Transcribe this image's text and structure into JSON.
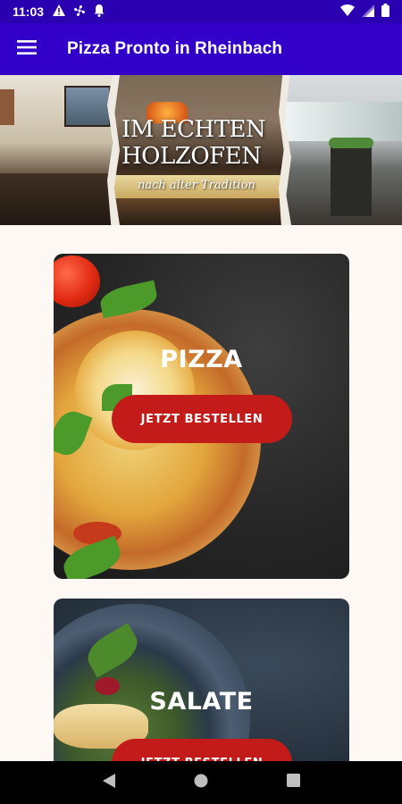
{
  "status_bar": {
    "time": "11:03",
    "icons_left": [
      "alert-icon",
      "fan-icon",
      "bell-icon"
    ],
    "icons_right": [
      "wifi-icon",
      "signal-icon",
      "battery-icon"
    ]
  },
  "app_bar": {
    "title": "Pizza Pronto in Rheinbach",
    "menu_icon": "hamburger-menu-icon"
  },
  "hero": {
    "headline_line1": "IM ECHTEN",
    "headline_line2": "HOLZOFEN",
    "subline": "nach alter Tradition"
  },
  "categories": [
    {
      "title": "PIZZA",
      "button_label": "JETZT BESTELLEN"
    },
    {
      "title": "SALATE",
      "button_label": "JETZT BESTELLEN"
    }
  ],
  "nav_bar": {
    "buttons": [
      "back-icon",
      "home-icon",
      "recents-icon"
    ]
  },
  "colors": {
    "status_bar": "#2b00b0",
    "app_bar": "#3200c8",
    "button": "#c31a1a",
    "background": "#fdf8f3"
  }
}
